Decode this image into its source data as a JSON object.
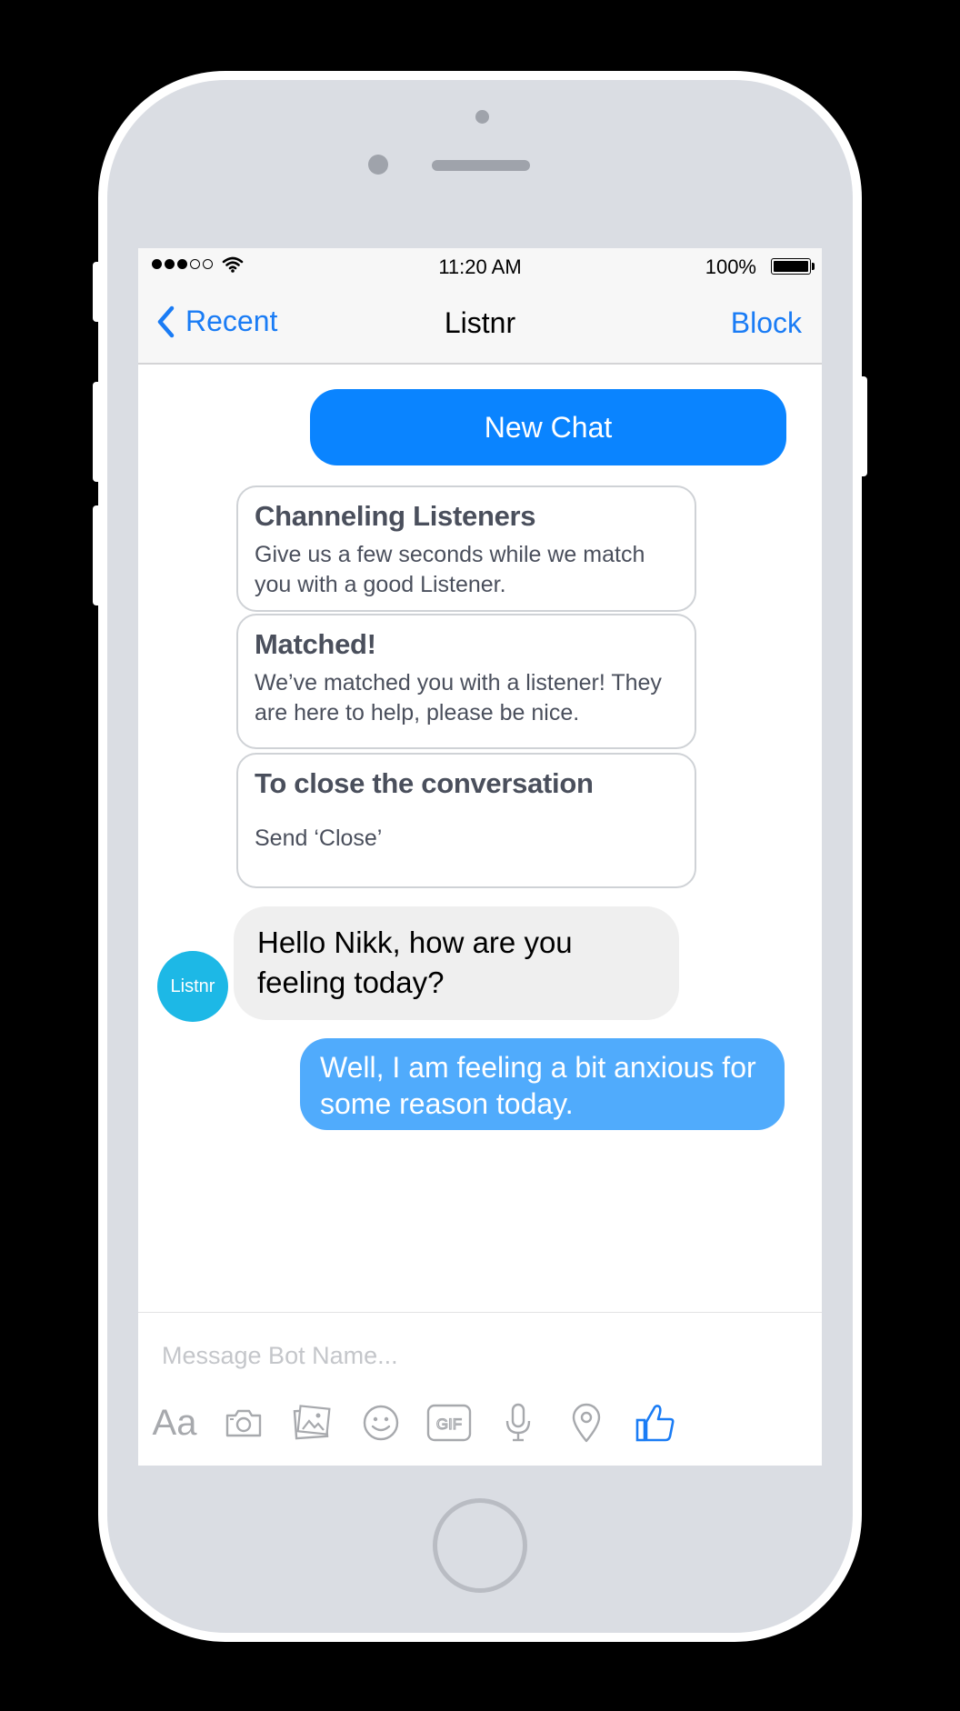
{
  "status_bar": {
    "time": "11:20 AM",
    "battery": "100%"
  },
  "nav": {
    "back_label": "Recent",
    "title": "Listnr",
    "block_label": "Block"
  },
  "chat": {
    "new_chat_label": "New Chat",
    "cards": [
      {
        "title": "Channeling Listeners",
        "body": "Give us a few seconds while we match you with a good Listener."
      },
      {
        "title": "Matched!",
        "body": "We’ve matched you with a listener! They are here to help, please be nice."
      },
      {
        "title": "To close the conversation",
        "body": "Send ‘Close’"
      }
    ],
    "avatar_label": "Listnr",
    "incoming_message": "Hello Nikk, how are you feeling today?",
    "outgoing_message": "Well, I am feeling a bit anxious for some reason today."
  },
  "composer": {
    "placeholder": "Message Bot Name...",
    "aa_label": "Aa"
  },
  "icons": [
    "camera-icon",
    "photos-icon",
    "emoji-icon",
    "gif-icon",
    "microphone-icon",
    "location-icon",
    "thumbs-up-icon"
  ],
  "colors": {
    "accent": "#1a7cf5",
    "new_chat_bg": "#0a84ff",
    "outgoing_bubble": "#50abfc",
    "incoming_bubble": "#efefef",
    "avatar": "#1db8e6"
  }
}
